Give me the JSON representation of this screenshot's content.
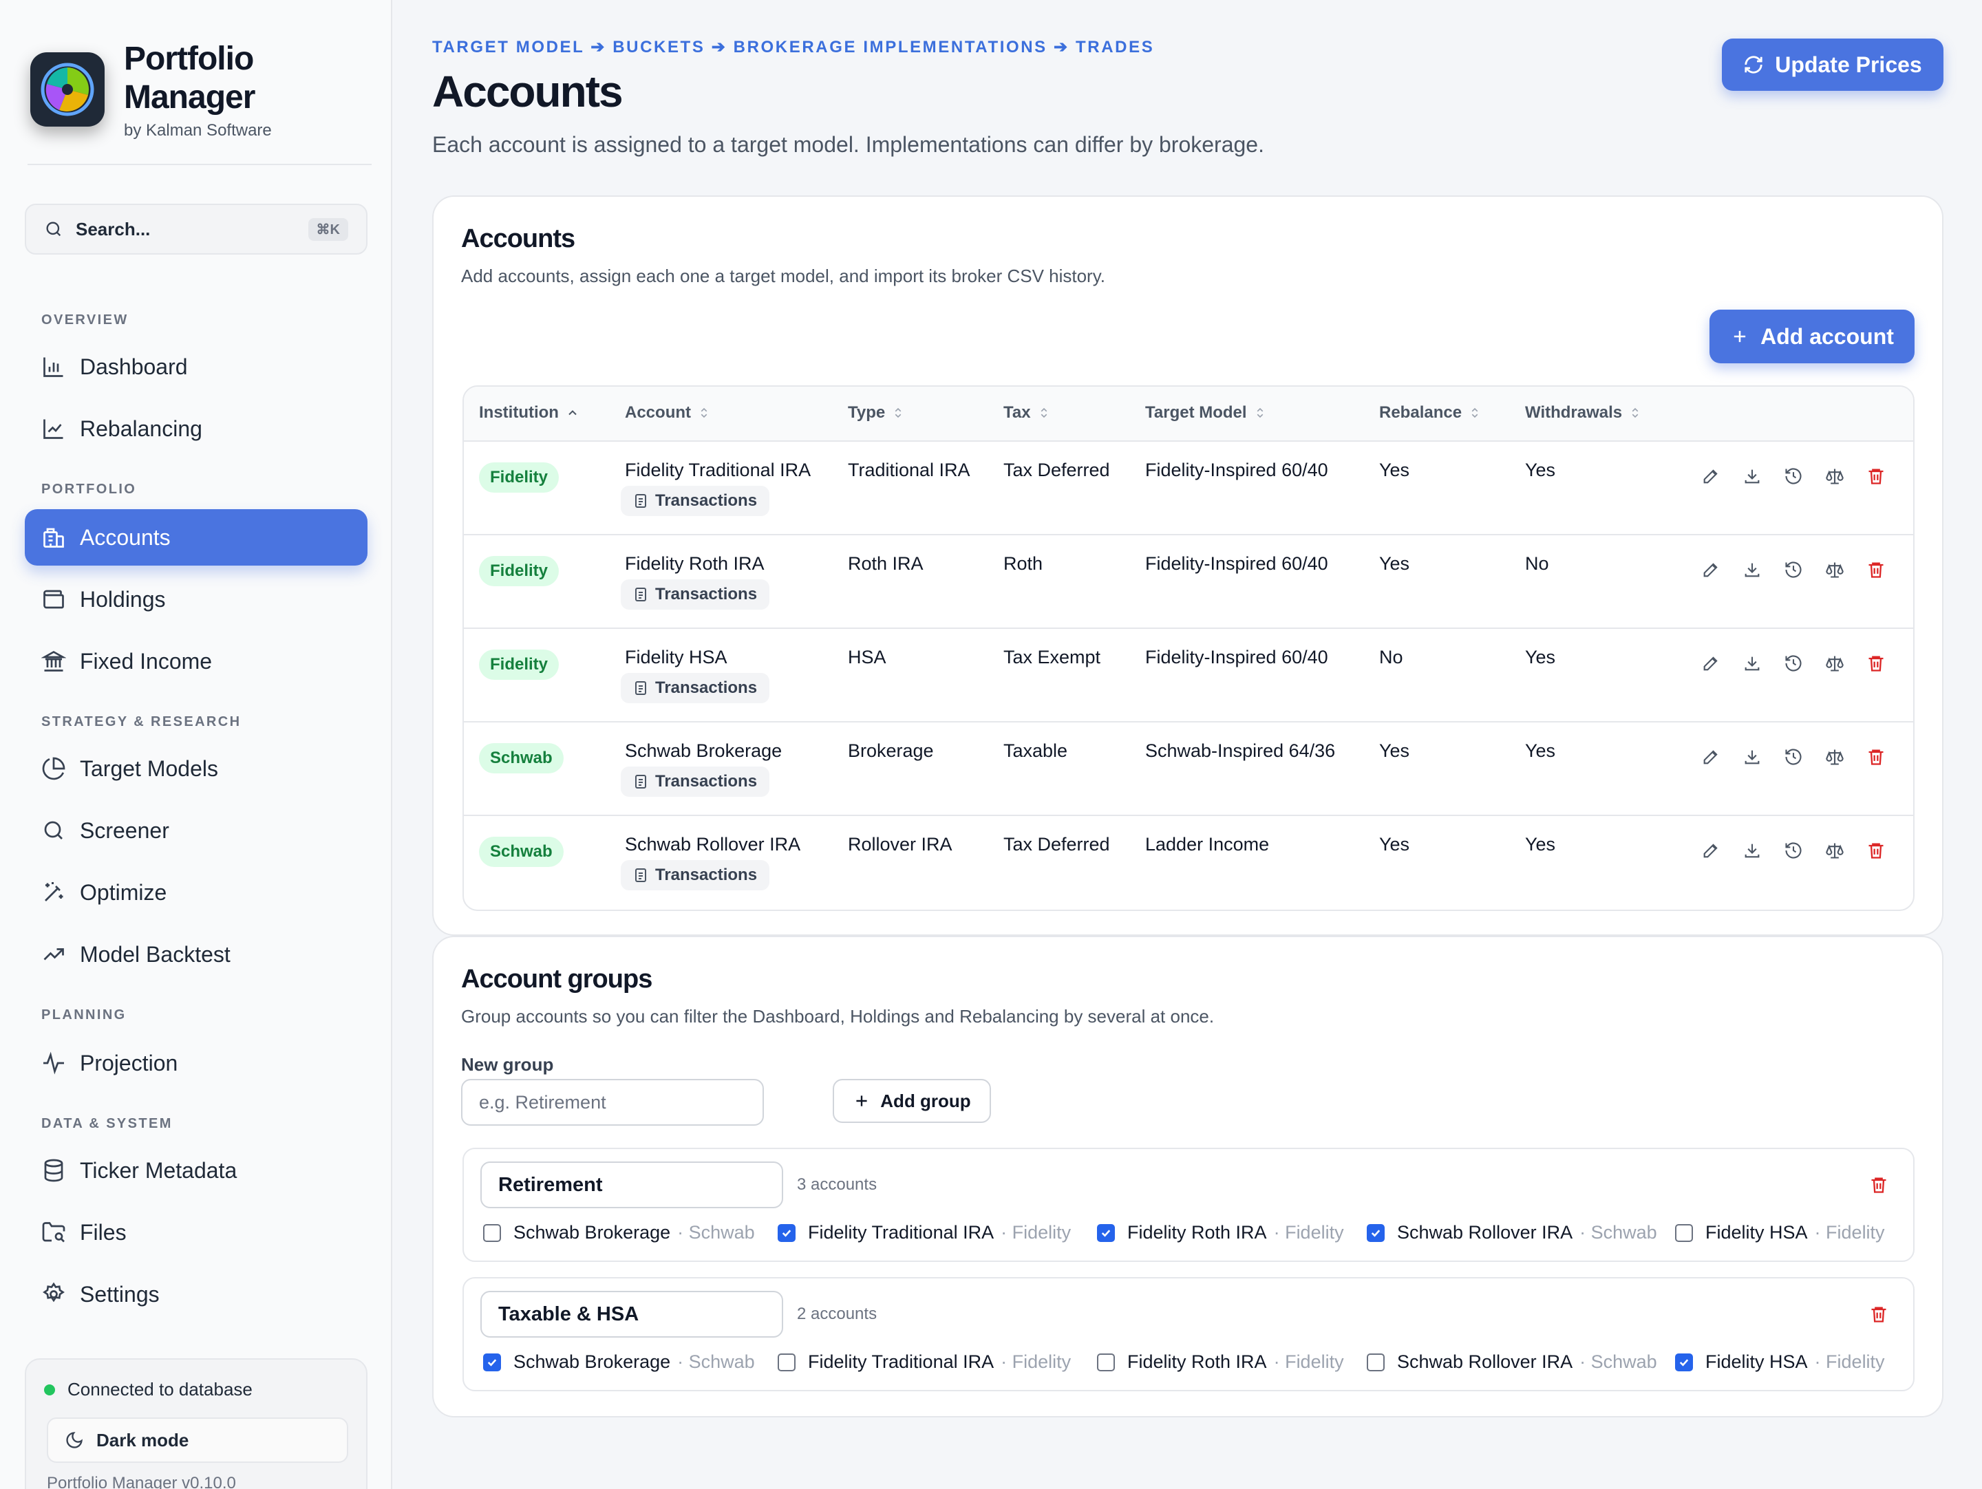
{
  "app": {
    "title": "Portfolio Manager",
    "subtitle": "by Kalman Software"
  },
  "search": {
    "placeholder": "Search...",
    "shortcut": "⌘K"
  },
  "nav": {
    "overview_heading": "OVERVIEW",
    "dashboard": "Dashboard",
    "rebalancing": "Rebalancing",
    "portfolio_heading": "PORTFOLIO",
    "accounts": "Accounts",
    "holdings": "Holdings",
    "fixed_income": "Fixed Income",
    "strategy_heading": "STRATEGY & RESEARCH",
    "target_models": "Target Models",
    "screener": "Screener",
    "optimize": "Optimize",
    "model_backtest": "Model Backtest",
    "planning_heading": "PLANNING",
    "projection": "Projection",
    "data_heading": "DATA & SYSTEM",
    "ticker_metadata": "Ticker Metadata",
    "files": "Files",
    "settings": "Settings"
  },
  "status": {
    "connection": "Connected to database",
    "dark_mode": "Dark mode",
    "version": "Portfolio Manager v0.10.0"
  },
  "header": {
    "breadcrumb": "TARGET MODEL ➔ BUCKETS ➔ BROKERAGE IMPLEMENTATIONS ➔ TRADES",
    "title": "Accounts",
    "subtitle": "Each account is assigned to a target model. Implementations can differ by brokerage.",
    "update_prices": "Update Prices"
  },
  "accounts_card": {
    "title": "Accounts",
    "subtitle": "Add accounts, assign each one a target model, and import its broker CSV history.",
    "add_button": "Add account",
    "columns": {
      "institution": "Institution",
      "account": "Account",
      "type": "Type",
      "tax": "Tax",
      "target_model": "Target Model",
      "rebalance": "Rebalance",
      "withdrawals": "Withdrawals"
    },
    "transactions_label": "Transactions",
    "rows": [
      {
        "institution": "Fidelity",
        "account": "Fidelity Traditional IRA",
        "type": "Traditional IRA",
        "tax": "Tax Deferred",
        "target_model": "Fidelity-Inspired 60/40",
        "rebalance": "Yes",
        "withdrawals": "Yes"
      },
      {
        "institution": "Fidelity",
        "account": "Fidelity Roth IRA",
        "type": "Roth IRA",
        "tax": "Roth",
        "target_model": "Fidelity-Inspired 60/40",
        "rebalance": "Yes",
        "withdrawals": "No"
      },
      {
        "institution": "Fidelity",
        "account": "Fidelity HSA",
        "type": "HSA",
        "tax": "Tax Exempt",
        "target_model": "Fidelity-Inspired 60/40",
        "rebalance": "No",
        "withdrawals": "Yes"
      },
      {
        "institution": "Schwab",
        "account": "Schwab Brokerage",
        "type": "Brokerage",
        "tax": "Taxable",
        "target_model": "Schwab-Inspired 64/36",
        "rebalance": "Yes",
        "withdrawals": "Yes"
      },
      {
        "institution": "Schwab",
        "account": "Schwab Rollover IRA",
        "type": "Rollover IRA",
        "tax": "Tax Deferred",
        "target_model": "Ladder Income",
        "rebalance": "Yes",
        "withdrawals": "Yes"
      }
    ]
  },
  "groups_card": {
    "title": "Account groups",
    "subtitle": "Group accounts so you can filter the Dashboard, Holdings and Rebalancing by several at once.",
    "new_group_label": "New group",
    "new_group_placeholder": "e.g. Retirement",
    "add_group": "Add group",
    "groups": [
      {
        "name": "Retirement",
        "count": "3 accounts",
        "members": [
          {
            "account": "Schwab Brokerage",
            "institution": "· Schwab",
            "checked": false
          },
          {
            "account": "Fidelity Traditional IRA",
            "institution": "· Fidelity",
            "checked": true
          },
          {
            "account": "Fidelity Roth IRA",
            "institution": "· Fidelity",
            "checked": true
          },
          {
            "account": "Schwab Rollover IRA",
            "institution": "· Schwab",
            "checked": true
          },
          {
            "account": "Fidelity HSA",
            "institution": "· Fidelity",
            "checked": false
          }
        ]
      },
      {
        "name": "Taxable & HSA",
        "count": "2 accounts",
        "members": [
          {
            "account": "Schwab Brokerage",
            "institution": "· Schwab",
            "checked": true
          },
          {
            "account": "Fidelity Traditional IRA",
            "institution": "· Fidelity",
            "checked": false
          },
          {
            "account": "Fidelity Roth IRA",
            "institution": "· Fidelity",
            "checked": false
          },
          {
            "account": "Schwab Rollover IRA",
            "institution": "· Schwab",
            "checked": false
          },
          {
            "account": "Fidelity HSA",
            "institution": "· Fidelity",
            "checked": true
          }
        ]
      }
    ]
  },
  "colors": {
    "accent": "#4a74e0",
    "link": "#3b6fdc",
    "badge_bg": "#dcfce7",
    "badge_text": "#15803d",
    "danger": "#dc2626"
  }
}
